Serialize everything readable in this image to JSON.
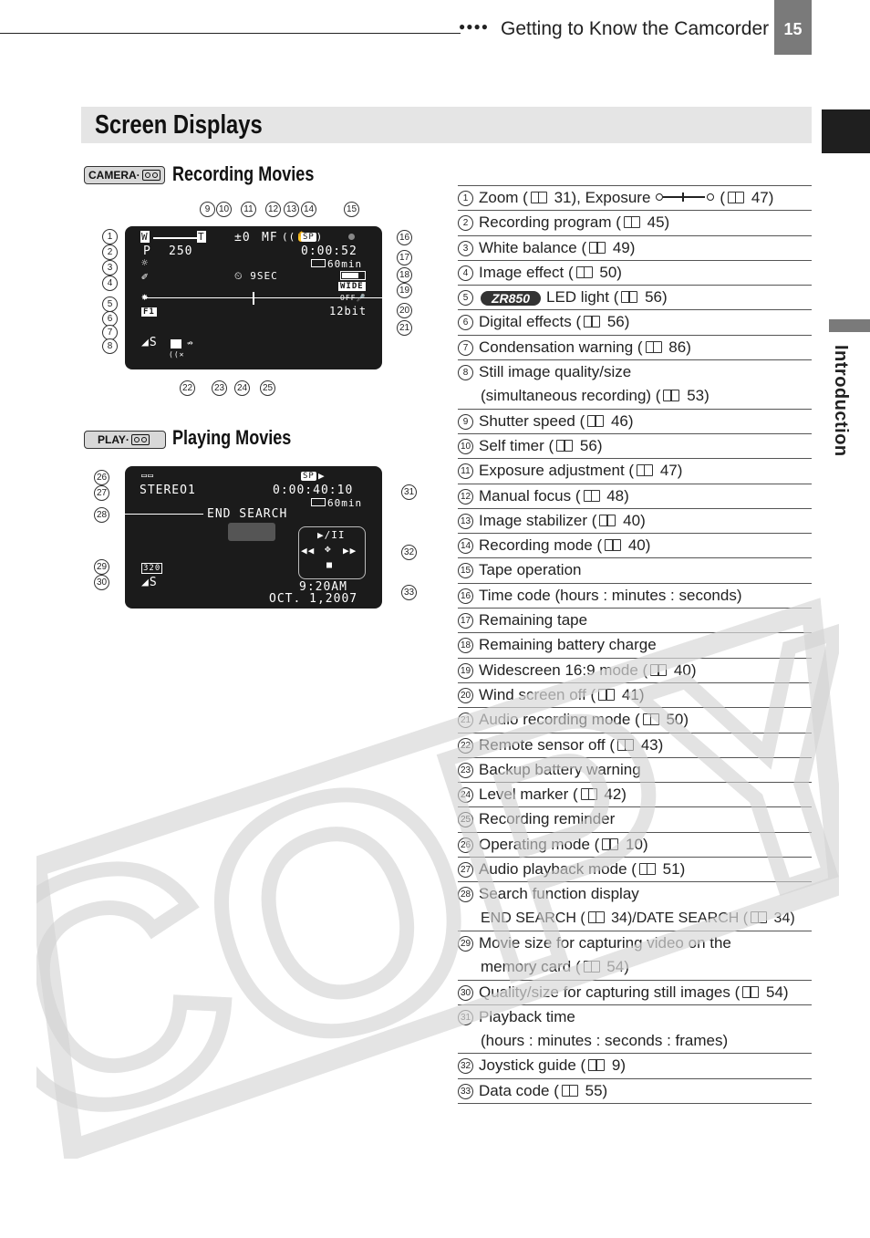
{
  "header": {
    "section_dots": "●●●●",
    "chapter_title": "Getting to Know the Camcorder",
    "page_number": "15",
    "side_tab_label": "Introduction"
  },
  "section": {
    "title": "Screen Displays"
  },
  "recording": {
    "mode_badge": "CAMERA·",
    "mode_icon": "tape-icon",
    "title": "Recording Movies",
    "lcd": {
      "zoom_w": "W",
      "zoom_t": "T",
      "program": "P",
      "shutter": "250",
      "exposure": "±0",
      "focus": "MF",
      "rec_mode": "SP",
      "timecode": "0:00:52",
      "remaining_tape": "60min",
      "widescreen": "WIDE",
      "self_timer": "9SEC",
      "audio_mode": "12bit",
      "digital_effect": "F1",
      "wind_off": "OFF",
      "quality": "S"
    },
    "callouts_top": [
      "9",
      "10",
      "11",
      "12",
      "13",
      "14",
      "15"
    ],
    "callouts_left": [
      "1",
      "2",
      "3",
      "4",
      "5",
      "6",
      "7",
      "8"
    ],
    "callouts_right": [
      "16",
      "17",
      "18",
      "19",
      "20",
      "21"
    ],
    "callouts_bottom": [
      "22",
      "23",
      "24",
      "25"
    ]
  },
  "playing": {
    "mode_badge": "PLAY·",
    "mode_icon": "tape-icon",
    "title": "Playing Movies",
    "lcd": {
      "rec_mode": "SP",
      "audio": "STEREO1",
      "timecode": "0:00:40:10",
      "remaining_tape": "60min",
      "search": "END SEARCH",
      "play_pause": "▶/II",
      "rewind": "◀◀",
      "ff": "▶▶",
      "stop": "■",
      "movie_size": "320",
      "quality": "S",
      "time": "9:20AM",
      "date": "OCT. 1,2007"
    },
    "callouts_left": [
      "26",
      "27",
      "28",
      "29",
      "30"
    ],
    "callouts_right": [
      "31",
      "32",
      "33"
    ]
  },
  "legend": [
    {
      "num": "1",
      "text": "Zoom (",
      "ref": "31",
      "extra": "), Exposure",
      "ref2": "47"
    },
    {
      "num": "2",
      "text": "Recording program (",
      "ref": "45",
      "tail": ")"
    },
    {
      "num": "3",
      "text": "White balance (",
      "ref": "49",
      "tail": ")"
    },
    {
      "num": "4",
      "text": "Image effect (",
      "ref": "50",
      "tail": ")"
    },
    {
      "num": "5",
      "badge": "ZR850",
      "text": "LED light (",
      "ref": "56",
      "tail": ")"
    },
    {
      "num": "6",
      "text": "Digital effects (",
      "ref": "56",
      "tail": ")"
    },
    {
      "num": "7",
      "text": "Condensation warning (",
      "ref": "86",
      "tail": ")"
    },
    {
      "num": "8",
      "text": "Still image quality/size",
      "sub": "(simultaneous recording) (",
      "sub_ref": "53",
      "sub_tail": ")"
    },
    {
      "num": "9",
      "text": "Shutter speed (",
      "ref": "46",
      "tail": ")"
    },
    {
      "num": "10",
      "text": "Self timer (",
      "ref": "56",
      "tail": ")"
    },
    {
      "num": "11",
      "text": "Exposure adjustment (",
      "ref": "47",
      "tail": ")"
    },
    {
      "num": "12",
      "text": "Manual focus (",
      "ref": "48",
      "tail": ")"
    },
    {
      "num": "13",
      "text": "Image stabilizer (",
      "ref": "40",
      "tail": ")"
    },
    {
      "num": "14",
      "text": "Recording mode (",
      "ref": "40",
      "tail": ")"
    },
    {
      "num": "15",
      "text": "Tape operation"
    },
    {
      "num": "16",
      "text": "Time code (hours : minutes : seconds)"
    },
    {
      "num": "17",
      "text": "Remaining tape"
    },
    {
      "num": "18",
      "text": "Remaining battery charge"
    },
    {
      "num": "19",
      "text": "Widescreen 16:9 mode (",
      "ref": "40",
      "tail": ")"
    },
    {
      "num": "20",
      "text": "Wind screen off (",
      "ref": "41",
      "tail": ")"
    },
    {
      "num": "21",
      "text": "Audio recording mode (",
      "ref": "50",
      "tail": ")"
    },
    {
      "num": "22",
      "text": "Remote sensor off (",
      "ref": "43",
      "tail": ")"
    },
    {
      "num": "23",
      "text": "Backup battery warning"
    },
    {
      "num": "24",
      "text": "Level marker (",
      "ref": "42",
      "tail": ")"
    },
    {
      "num": "25",
      "text": "Recording reminder"
    },
    {
      "num": "26",
      "text": "Operating mode (",
      "ref": "10",
      "tail": ")"
    },
    {
      "num": "27",
      "text": "Audio playback mode (",
      "ref": "51",
      "tail": ")"
    },
    {
      "num": "28",
      "text": "Search function display",
      "sub_small": "END SEARCH (",
      "sub_ref": "34",
      "sub_mid": ")/DATE SEARCH (",
      "sub_ref2": "34",
      "sub_tail": ")"
    },
    {
      "num": "29",
      "text": "Movie size for capturing video on the",
      "sub": "memory card (",
      "sub_ref": "54",
      "sub_tail": ")"
    },
    {
      "num": "30",
      "text": "Quality/size for capturing still images (",
      "ref": "54",
      "tail": ")"
    },
    {
      "num": "31",
      "text": "Playback time",
      "sub": "(hours : minutes : seconds : frames)"
    },
    {
      "num": "32",
      "text": "Joystick guide (",
      "ref": "9",
      "tail": ")"
    },
    {
      "num": "33",
      "text": "Data code (",
      "ref": "55",
      "tail": ")"
    }
  ],
  "watermark": "COPY"
}
